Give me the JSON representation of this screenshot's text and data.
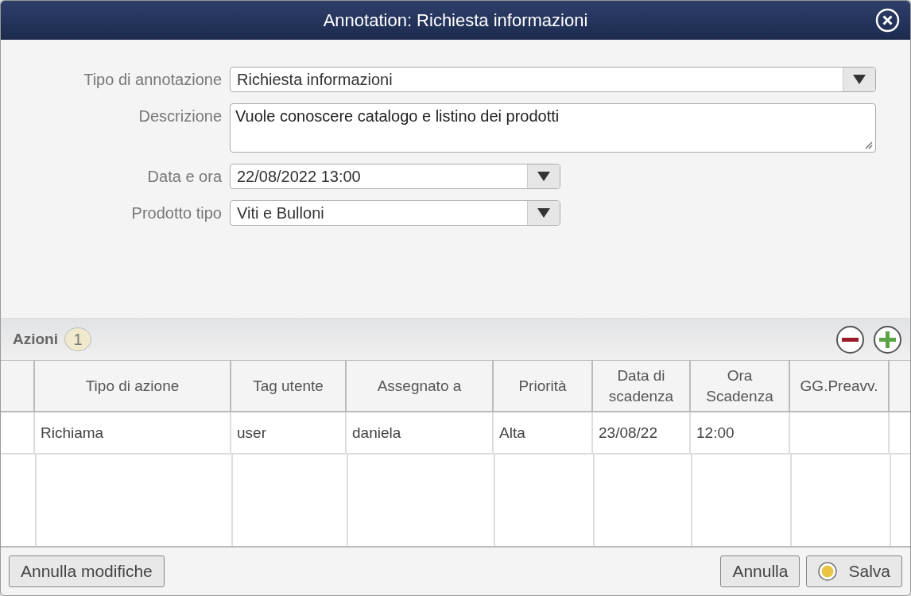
{
  "window": {
    "title": "Annotation: Richiesta informazioni"
  },
  "form": [
    {
      "kind": "select",
      "label": "Tipo di annotazione",
      "value": "Richiesta informazioni"
    },
    {
      "kind": "textarea",
      "label": "Descrizione",
      "value": "Vuole conoscere catalogo e listino dei prodotti"
    },
    {
      "kind": "select",
      "label": "Data e ora",
      "value": "22/08/2022 13:00"
    },
    {
      "kind": "select",
      "label": "Prodotto tipo",
      "value": "Viti e Bulloni"
    }
  ],
  "actions": {
    "title": "Azioni",
    "count": "1",
    "columns": [
      "Tipo di azione",
      "Tag utente",
      "Assegnato a",
      "Priorità",
      "Data di scadenza",
      "Ora Scadenza",
      "GG.Preavv."
    ],
    "rows": [
      [
        "Richiama",
        "user",
        "daniela",
        "Alta",
        "23/08/22",
        "12:00",
        ""
      ]
    ]
  },
  "buttons": [
    "Annulla modifiche",
    "Annulla",
    "Salva"
  ]
}
